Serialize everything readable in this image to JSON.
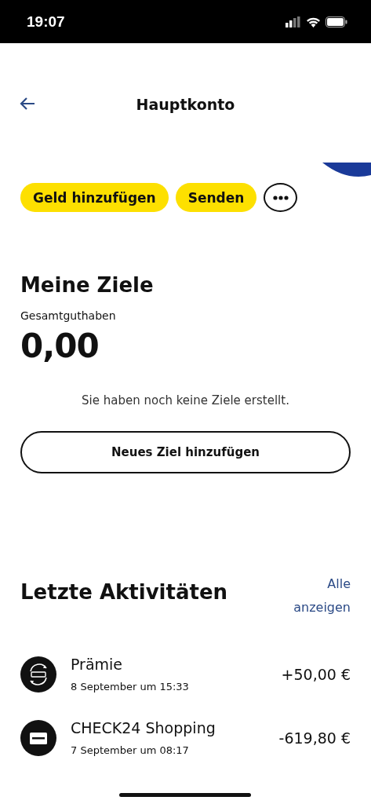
{
  "status_bar": {
    "time": "19:07"
  },
  "header": {
    "title": "Hauptkonto"
  },
  "actions": [
    {
      "label": "Geld hinzufügen",
      "kind": "primary"
    },
    {
      "label": "Senden",
      "kind": "primary"
    },
    {
      "kind": "more"
    }
  ],
  "goals": {
    "title": "Meine Ziele",
    "balance_label": "Gesamtguthaben",
    "balance": "0,00",
    "empty_text": "Sie haben noch keine Ziele erstellt.",
    "add_button": "Neues Ziel hinzufügen"
  },
  "activities": {
    "title": "Letzte Aktivitäten",
    "see_all": "Alle anzeigen",
    "items": [
      {
        "name": "Prämie",
        "date": "8 September um 15:33",
        "amount": "+50,00 €",
        "kind": "transfer"
      },
      {
        "name": "CHECK24 Shopping",
        "date": "7 September um 08:17",
        "amount": "-619,80 €",
        "kind": "card"
      }
    ]
  }
}
